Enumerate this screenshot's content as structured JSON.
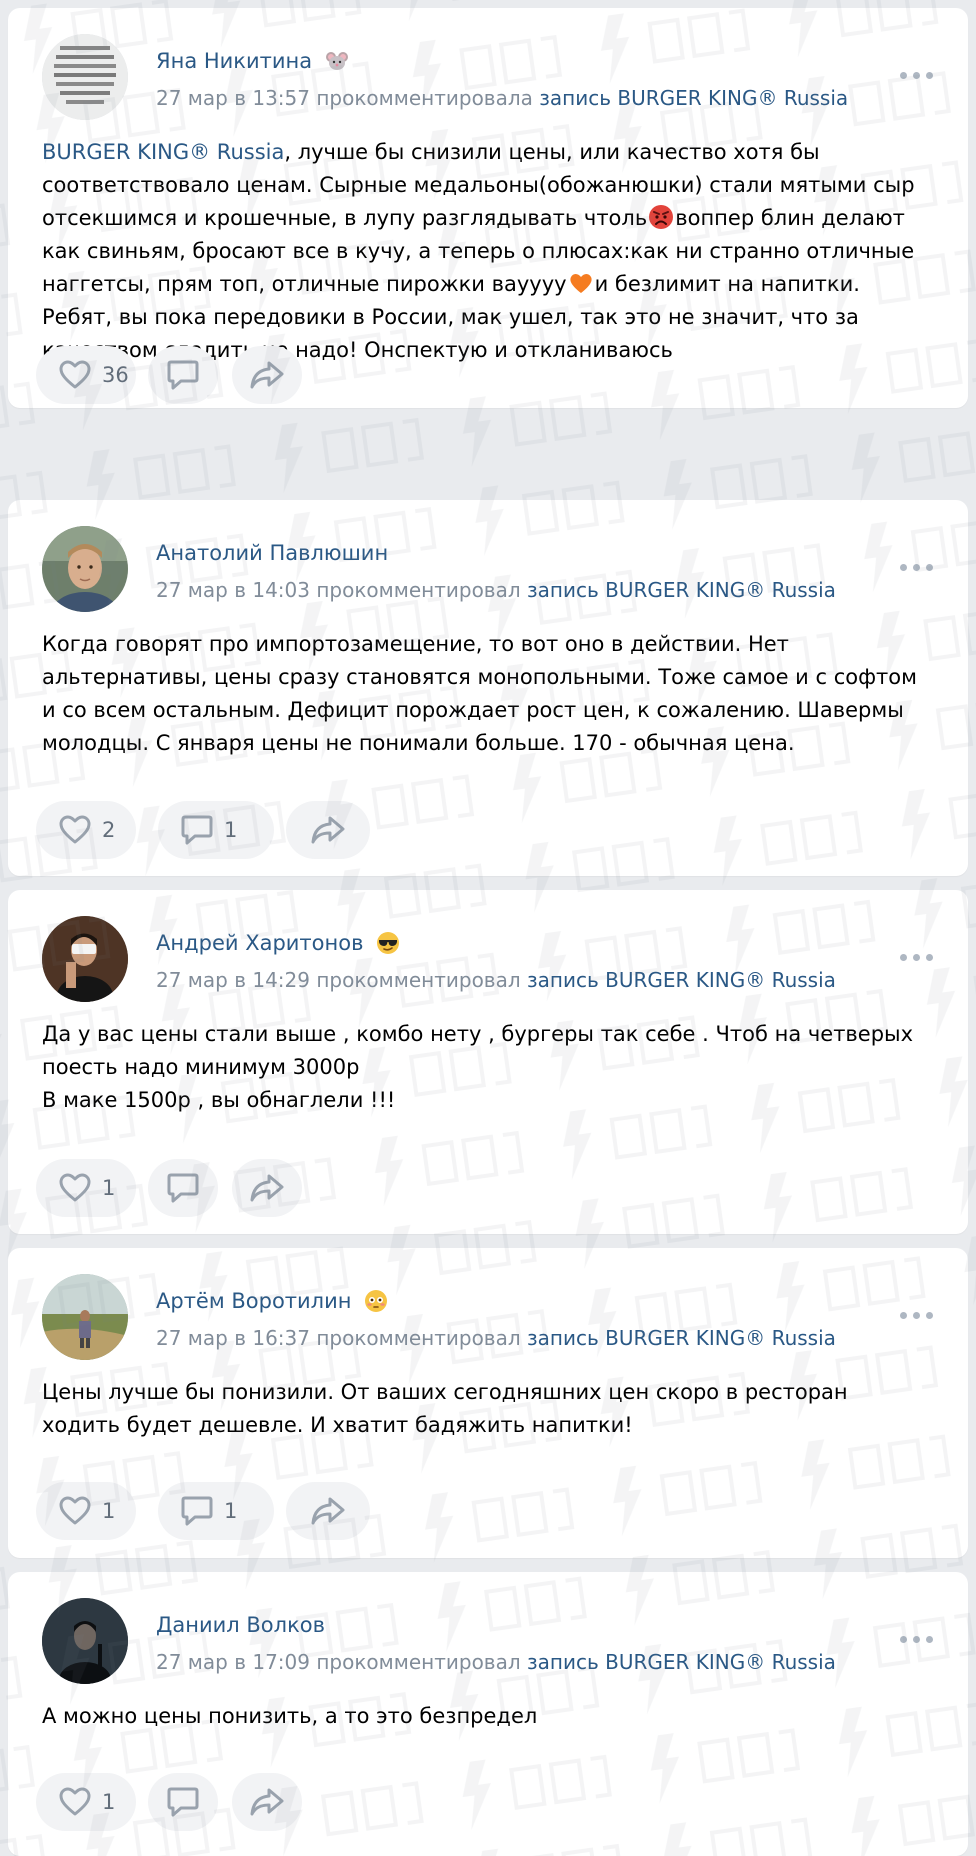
{
  "comments": [
    {
      "author": "Яна Никитина",
      "author_emoji": "mouse-emoji",
      "date": "27 мар в 13:57",
      "action": "прокомментировала",
      "post_link": "запись BURGER KING® Russia",
      "mention": "BURGER KING® Russia",
      "text_parts": [
        ", лучше бы снизили цены, или качество хотя бы соответствовало ценам. Сырные медальоны(обожанюшки) стали мятыми сыр отсекшимся и крошечные, в лупу разглядывать чтоль",
        "воппер блин делают как свиньям, бросают все в кучу, а теперь о плюсах:как ни странно отличные наггетсы, прям топ, отличные пирожки вауууу",
        "и безлимит на напитки. Ребят, вы пока передовики в России, мак ушел, так это не значит, что за качеством следить не надо! Онспектую и откланиваюсь"
      ],
      "inline_emojis": [
        "angry-face-emoji",
        "orange-heart-emoji"
      ],
      "likes": "36",
      "comments_count": ""
    },
    {
      "author": "Анатолий Павлюшин",
      "date": "27 мар в 14:03",
      "action": "прокомментировал",
      "post_link": "запись BURGER KING® Russia",
      "text": "Когда говорят про импортозамещение, то вот оно в действии. Нет альтернативы, цены сразу становятся монопольными. Тоже самое и с софтом и со всем остальным. Дефицит порождает рост цен, к сожалению. Шавермы молодцы. С января цены не понимали больше. 170 - обычная цена.",
      "likes": "2",
      "comments_count": "1"
    },
    {
      "author": "Андрей Харитонов",
      "author_emoji": "sunglasses-emoji",
      "date": "27 мар в 14:29",
      "action": "прокомментировал",
      "post_link": "запись BURGER KING® Russia",
      "text_line1": "Да у вас цены стали выше , комбо нету , бургеры так себе . Чтоб на четверых поесть надо минимум 3000р",
      "text_line2": "В маке 1500р , вы обнаглели !!!",
      "likes": "1",
      "comments_count": ""
    },
    {
      "author": "Артём Воротилин",
      "author_emoji": "flushed-face-emoji",
      "date": "27 мар в 16:37",
      "action": "прокомментировал",
      "post_link": "запись BURGER KING® Russia",
      "text": "Цены лучше бы понизили. От ваших сегодняшних цен скоро в ресторан ходить будет дешевле. И хватит бадяжить напитки!",
      "likes": "1",
      "comments_count": "1"
    },
    {
      "author": "Даниил Волков",
      "date": "27 мар в 17:09",
      "action": "прокомментировал",
      "post_link": "запись BURGER KING® Russia",
      "text": "А можно цены понизить, а то это безпредел",
      "likes": "1",
      "comments_count": ""
    }
  ],
  "colors": {
    "background": "#e9ebee",
    "card": "#ffffff",
    "link": "#2a5885",
    "meta": "#818c99",
    "action_bg": "#f2f3f5",
    "action_icon": "#99a2ad"
  },
  "icons": {
    "like": "heart-outline-icon",
    "comment": "speech-bubble-icon",
    "share": "share-arrow-icon",
    "more": "three-dots-icon"
  }
}
